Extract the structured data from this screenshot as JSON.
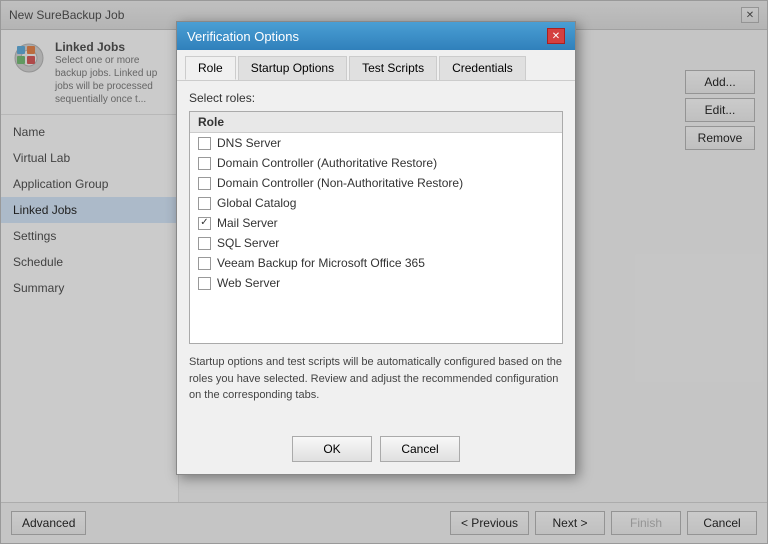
{
  "window": {
    "title": "New SureBackup Job",
    "close_label": "✕"
  },
  "sidebar": {
    "header": {
      "title": "Linked Jobs",
      "description": "Select one or more backup jobs. Linked up jobs will be processed sequentially once t..."
    },
    "items": [
      {
        "id": "name",
        "label": "Name"
      },
      {
        "id": "virtual-lab",
        "label": "Virtual Lab"
      },
      {
        "id": "application-group",
        "label": "Application Group"
      },
      {
        "id": "linked-jobs",
        "label": "Linked Jobs",
        "active": true
      },
      {
        "id": "settings",
        "label": "Settings"
      },
      {
        "id": "schedule",
        "label": "Schedule"
      },
      {
        "id": "summary",
        "label": "Summary"
      }
    ]
  },
  "right_buttons": {
    "add": "Add...",
    "edit": "Edit...",
    "remove": "Remove"
  },
  "bottom_buttons": {
    "advanced": "Advanced",
    "previous": "< Previous",
    "next": "Next >",
    "finish": "Finish",
    "cancel": "Cancel"
  },
  "dialog": {
    "title": "Verification Options",
    "close_label": "✕",
    "tabs": [
      {
        "id": "role",
        "label": "Role",
        "active": true
      },
      {
        "id": "startup-options",
        "label": "Startup Options"
      },
      {
        "id": "test-scripts",
        "label": "Test Scripts"
      },
      {
        "id": "credentials",
        "label": "Credentials"
      }
    ],
    "select_roles_label": "Select roles:",
    "roles_header": "Role",
    "roles": [
      {
        "id": "dns-server",
        "label": "DNS Server",
        "checked": false
      },
      {
        "id": "domain-controller-auth",
        "label": "Domain Controller (Authoritative Restore)",
        "checked": false
      },
      {
        "id": "domain-controller-non-auth",
        "label": "Domain Controller (Non-Authoritative Restore)",
        "checked": false
      },
      {
        "id": "global-catalog",
        "label": "Global Catalog",
        "checked": false
      },
      {
        "id": "mail-server",
        "label": "Mail Server",
        "checked": true
      },
      {
        "id": "sql-server",
        "label": "SQL Server",
        "checked": false
      },
      {
        "id": "veeam-backup",
        "label": "Veeam Backup for Microsoft Office 365",
        "checked": false
      },
      {
        "id": "web-server",
        "label": "Web Server",
        "checked": false
      }
    ],
    "info_text": "Startup options and test scripts will be automatically configured based on the roles you have selected. Review and adjust the recommended configuration on the corresponding tabs.",
    "ok_label": "OK",
    "cancel_label": "Cancel"
  }
}
